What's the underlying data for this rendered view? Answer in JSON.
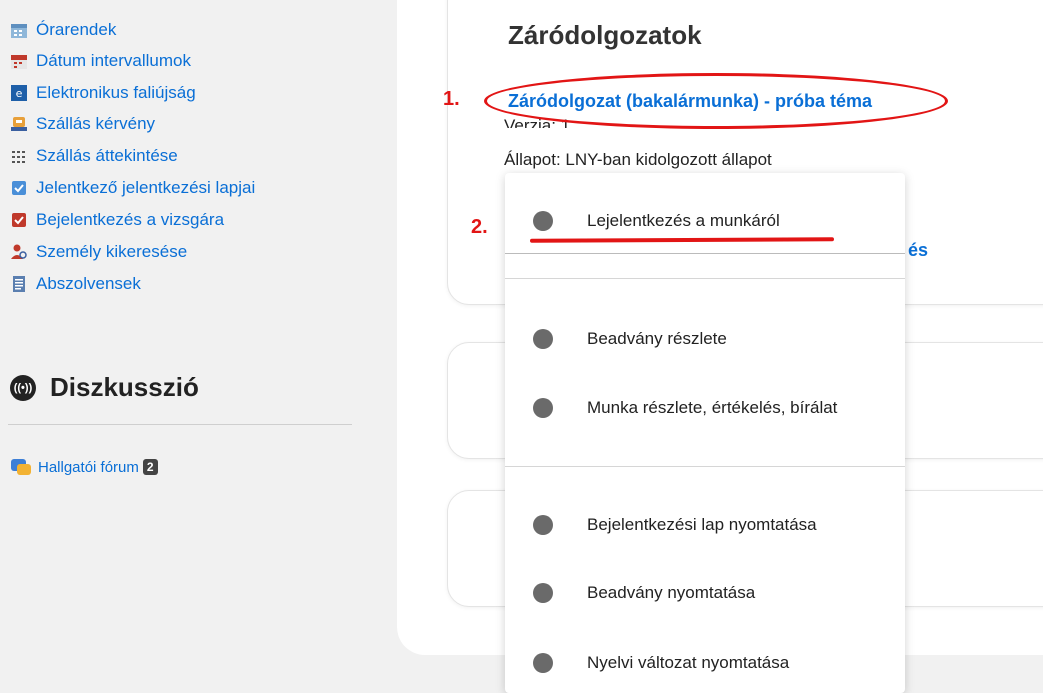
{
  "sidebar": {
    "items": [
      {
        "label": "Órarendek",
        "icon": "timetable-icon"
      },
      {
        "label": "Dátum intervallumok",
        "icon": "calendar-icon"
      },
      {
        "label": "Elektronikus faliújság",
        "icon": "e-board-icon"
      },
      {
        "label": "Szállás kérvény",
        "icon": "lodging-request-icon"
      },
      {
        "label": "Szállás áttekintése",
        "icon": "lodging-overview-icon"
      },
      {
        "label": "Jelentkező jelentkezési lapjai",
        "icon": "checkbox-icon"
      },
      {
        "label": "Bejelentkezés a vizsgára",
        "icon": "exam-icon"
      },
      {
        "label": "Személy kikeresése",
        "icon": "person-search-icon"
      },
      {
        "label": "Abszolvensek",
        "icon": "document-icon"
      }
    ],
    "discussion_title": "Diszkusszió",
    "forum_label": "Hallgatói fórum",
    "forum_count": "2"
  },
  "main": {
    "section_title": "Záródolgozatok",
    "work_link": "Záródolgozat (bakalármunka) - próba téma",
    "version": "Verzia: 1",
    "status": "Állapot: LNY-ban kidolgozott állapot",
    "behind_link_fragment": "és"
  },
  "annotations": {
    "one": "1.",
    "two": "2."
  },
  "dropdown": {
    "items": [
      "Lejelentkezés a munkáról",
      "Beadvány részlete",
      "Munka részlete, értékelés, bírálat",
      "Bejelentkezési lap nyomtatása",
      "Beadvány nyomtatása",
      "Nyelvi változat nyomtatása"
    ]
  },
  "colors": {
    "link": "#0a6fd6",
    "annotation": "#e21515",
    "background": "#f1f1f1"
  }
}
